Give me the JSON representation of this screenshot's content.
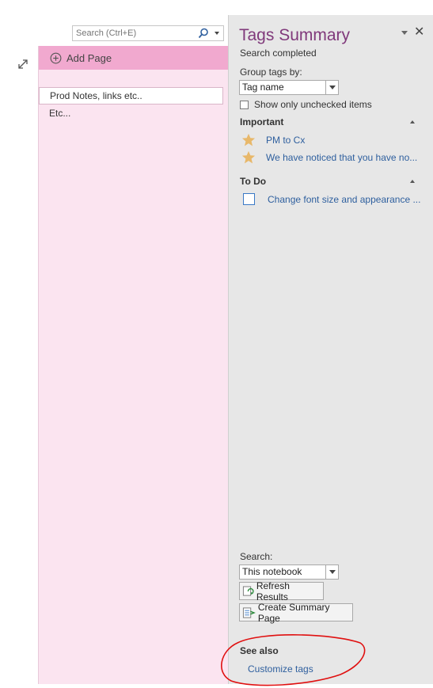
{
  "search": {
    "placeholder": "Search (Ctrl+E)"
  },
  "pages": {
    "add_page_label": "Add Page",
    "items": [
      {
        "title": "Prod Notes, links etc.."
      },
      {
        "title": "Etc..."
      }
    ]
  },
  "tags_pane": {
    "title": "Tags Summary",
    "status": "Search completed",
    "group_by_label": "Group tags by:",
    "group_by_value": "Tag name",
    "show_unchecked_label": "Show only unchecked items",
    "show_unchecked_checked": false,
    "sections": [
      {
        "heading": "Important",
        "items": [
          {
            "icon": "star-icon",
            "label": "PM to Cx"
          },
          {
            "icon": "star-icon",
            "label": "We have noticed that you have no..."
          }
        ]
      },
      {
        "heading": "To Do",
        "items": [
          {
            "icon": "todo-checkbox-icon",
            "label": "Change font size and appearance ..."
          }
        ]
      }
    ],
    "search_label": "Search:",
    "search_scope": "This notebook",
    "refresh_button": "Refresh Results",
    "create_summary_button": "Create Summary Page",
    "see_also_heading": "See also",
    "customize_link": "Customize tags"
  },
  "colors": {
    "title_purple": "#80397b",
    "link_blue": "#2e5f9e",
    "section_pink": "#fbe4f0",
    "add_page_pink": "#f1a9cf",
    "pane_gray": "#e7e7e7",
    "star_gold": "#e8b86a",
    "annotation_red": "#e01010"
  }
}
